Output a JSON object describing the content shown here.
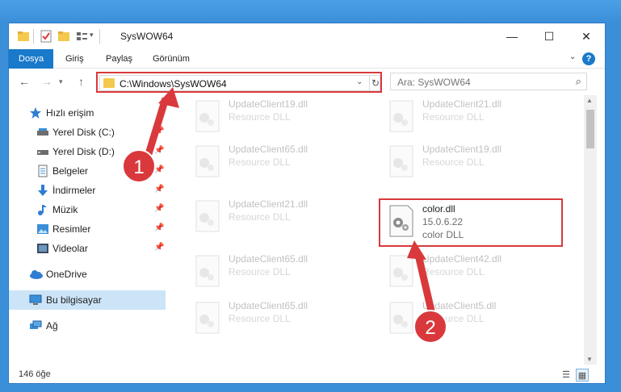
{
  "window": {
    "title": "SysWOW64",
    "controls": {
      "minimize": "—",
      "maximize": "☐",
      "close": "✕"
    }
  },
  "ribbon": {
    "tabs": [
      {
        "label": "Dosya",
        "active": true
      },
      {
        "label": "Giriş"
      },
      {
        "label": "Paylaş"
      },
      {
        "label": "Görünüm"
      }
    ],
    "help": "?"
  },
  "navigation": {
    "address": "C:\\Windows\\SysWOW64",
    "search_placeholder": "Ara: SysWOW64"
  },
  "sidebar": {
    "items": [
      {
        "label": "Hızlı erişim",
        "icon": "star-icon"
      },
      {
        "label": "Yerel Disk (C:)",
        "icon": "drive-icon",
        "pinned": true
      },
      {
        "label": "Yerel Disk (D:)",
        "icon": "drive-icon",
        "pinned": true
      },
      {
        "label": "Belgeler",
        "icon": "documents-icon",
        "pinned": true
      },
      {
        "label": "İndirmeler",
        "icon": "download-icon",
        "pinned": true
      },
      {
        "label": "Müzik",
        "icon": "music-icon",
        "pinned": true
      },
      {
        "label": "Resimler",
        "icon": "pictures-icon",
        "pinned": true
      },
      {
        "label": "Videolar",
        "icon": "videos-icon",
        "pinned": true
      },
      {
        "label": "OneDrive",
        "icon": "cloud-icon"
      },
      {
        "label": "Bu bilgisayar",
        "icon": "computer-icon",
        "selected": true
      },
      {
        "label": "Ağ",
        "icon": "network-icon"
      }
    ]
  },
  "files": [
    {
      "name": "UpdateClient19.dll",
      "desc": "Resource DLL"
    },
    {
      "name": "UpdateClient21.dll",
      "desc": "Resource DLL"
    },
    {
      "name": "UpdateClient65.dll",
      "desc": "Resource DLL"
    },
    {
      "name": "UpdateClient19.dll",
      "desc": "Resource DLL"
    },
    {
      "name": "UpdateClient21.dll",
      "desc": "Resource DLL"
    },
    {
      "name": "color.dll",
      "version": "15.0.6.22",
      "desc": "color DLL"
    },
    {
      "name": "UpdateClient65.dll",
      "desc": "Resource DLL"
    },
    {
      "name": "UpdateClient42.dll",
      "desc": "Resource DLL"
    },
    {
      "name": "UpdateClient65.dll",
      "desc": "Resource DLL"
    },
    {
      "name": "UpdateClient5.dll",
      "desc": "Resource DLL"
    }
  ],
  "status": {
    "count": "146 öğe"
  },
  "annotations": {
    "step1": "1",
    "step2": "2",
    "color": "#d9393c"
  }
}
